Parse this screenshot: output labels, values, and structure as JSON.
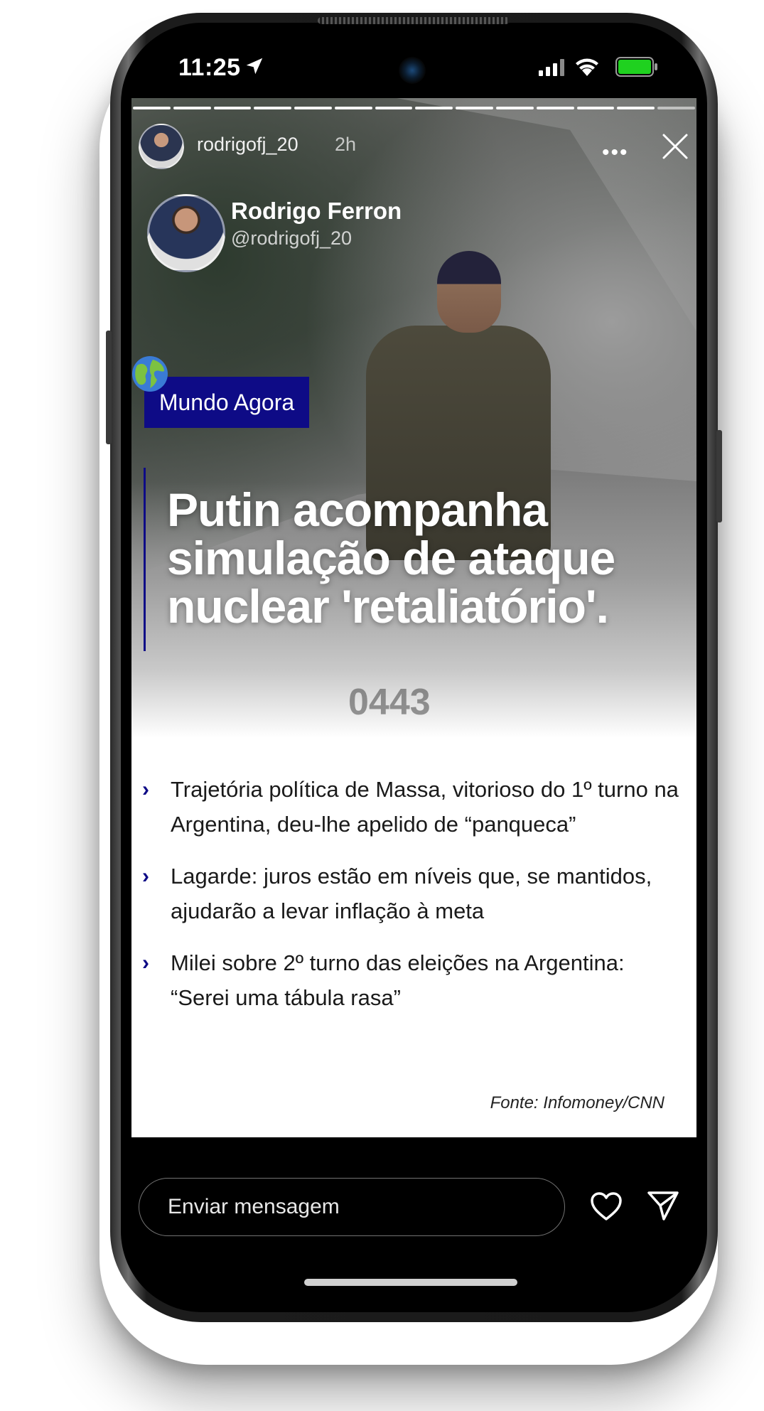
{
  "status_bar": {
    "time": "11:25"
  },
  "story": {
    "header": {
      "username": "rodrigofj_20",
      "time_ago": "2h"
    },
    "profile": {
      "name": "Rodrigo Ferron",
      "handle": "@rodrigofj_20"
    },
    "tag": "Mundo Agora",
    "headline": "Putin acompanha simulação de ataque nuclear 'retaliatório'.",
    "photo_text": "0443",
    "bullets": [
      "Trajetória política de Massa, vitorioso do 1º turno na Argentina, deu-lhe apelido de “panqueca”",
      "Lagarde: juros estão em níveis que, se mantidos, ajudarão a levar inflação à meta",
      "Milei sobre 2º turno das eleições na Argentina: “Serei uma tábula rasa”"
    ],
    "source": "Fonte: Infomoney/CNN"
  },
  "bottom_bar": {
    "message_placeholder": "Enviar mensagem"
  },
  "colors": {
    "accent": "#0e0b86",
    "battery": "#1fd11f"
  }
}
